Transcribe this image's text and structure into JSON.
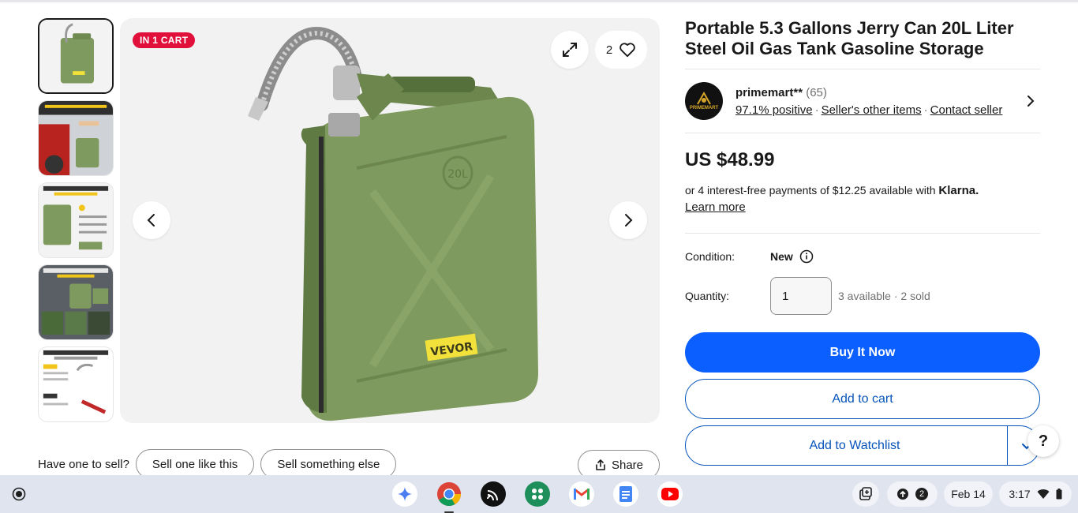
{
  "main_image": {
    "badge": "IN 1 CART",
    "watch_count": "2",
    "product_label": "VEVOR",
    "can_capacity": "20L"
  },
  "product": {
    "title": "Portable 5.3 Gallons Jerry Can 20L Liter Steel Oil Gas Tank Gasoline Storage"
  },
  "seller": {
    "name": "primemart**",
    "count": "(65)",
    "positive": "97.1% positive",
    "other_items": "Seller's other items",
    "contact": "Contact seller",
    "avatar_text": "PRIMEMART"
  },
  "pricing": {
    "price": "US $48.99",
    "installments_text": "or 4 interest-free payments of $12.25 available with",
    "klarna": "Klarna.",
    "learn_more": "Learn more"
  },
  "condition": {
    "label": "Condition:",
    "value": "New"
  },
  "quantity": {
    "label": "Quantity:",
    "value": "1",
    "available": "3 available",
    "sold": "2 sold"
  },
  "actions": {
    "buy_now": "Buy It Now",
    "add_to_cart": "Add to cart",
    "add_to_watchlist": "Add to Watchlist",
    "help": "?"
  },
  "sell_row": {
    "label": "Have one to sell?",
    "sell_like": "Sell one like this",
    "sell_else": "Sell something else",
    "share": "Share"
  },
  "taskbar": {
    "notifications_count": "2",
    "date": "Feb 14",
    "time": "3:17"
  },
  "colors": {
    "accent_blue": "#0b5fff",
    "link_blue": "#0654ba",
    "badge_red": "#e0103a",
    "can_green": "#7f9a5e"
  }
}
